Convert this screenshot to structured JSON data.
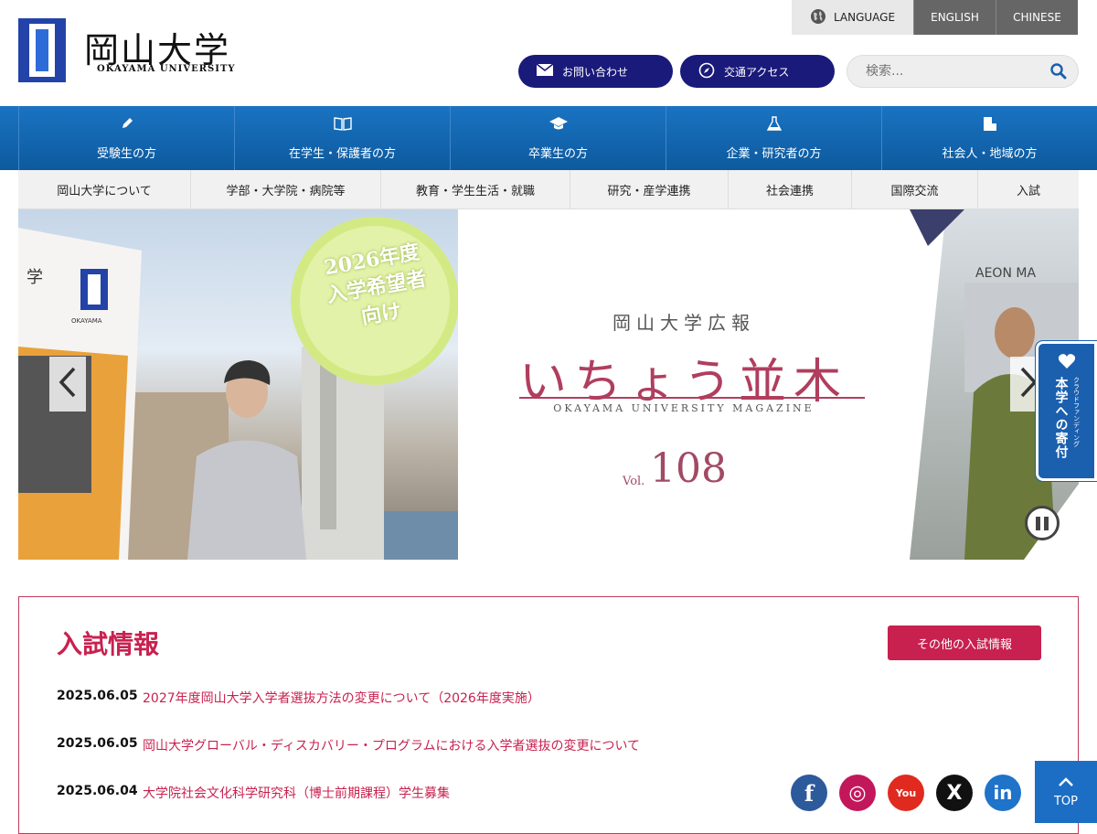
{
  "header": {
    "logo_jp": "岡山大学",
    "logo_en": "OKAYAMA UNIVERSITY",
    "language_label": "LANGUAGE",
    "languages": [
      "ENGLISH",
      "CHINESE"
    ],
    "contact_label": "お問い合わせ",
    "access_label": "交通アクセス",
    "search_placeholder": "検索..."
  },
  "audience_nav": [
    {
      "label": "受験生の方",
      "icon": "pencil-icon"
    },
    {
      "label": "在学生・保護者の方",
      "icon": "book-icon"
    },
    {
      "label": "卒業生の方",
      "icon": "graduation-cap-icon"
    },
    {
      "label": "企業・研究者の方",
      "icon": "flask-icon"
    },
    {
      "label": "社会人・地域の方",
      "icon": "building-icon"
    }
  ],
  "main_nav": [
    "岡山大学について",
    "学部・大学院・病院等",
    "教育・学生生活・就職",
    "研究・産学連携",
    "社会連携",
    "国際交流",
    "入試"
  ],
  "hero": {
    "badge_line1": "2026年度",
    "badge_line2": "入学希望者",
    "badge_line3": "向け",
    "side_char": "学",
    "card_text": "OKAYAMA",
    "magazine_kicker": "岡山大学広報",
    "magazine_title": "いちょう並木",
    "magazine_subtitle": "OKAYAMA UNIVERSITY MAGAZINE",
    "vol_label": "Vol.",
    "vol_number": "108",
    "right_sign": "AEON MA"
  },
  "donate": {
    "label": "本学への寄付",
    "sub": "クラウドファンディング"
  },
  "admissions": {
    "title": "入試情報",
    "more_label": "その他の入試情報",
    "news": [
      {
        "date": "2025.06.05",
        "title": "2027年度岡山大学入学者選抜方法の変更について（2026年度実施）"
      },
      {
        "date": "2025.06.05",
        "title": "岡山大学グローバル・ディスカバリー・プログラムにおける入学者選抜の変更について"
      },
      {
        "date": "2025.06.04",
        "title": "大学院社会文化科学研究科（博士前期課程）学生募集"
      }
    ]
  },
  "social": [
    {
      "name": "facebook-icon",
      "glyph": "f",
      "color": "#2d5a9b"
    },
    {
      "name": "instagram-icon",
      "glyph": "◎",
      "color": "#c2185b"
    },
    {
      "name": "youtube-icon",
      "glyph": "You",
      "color": "#e02a20"
    },
    {
      "name": "x-icon",
      "glyph": "X",
      "color": "#111111"
    },
    {
      "name": "linkedin-icon",
      "glyph": "in",
      "color": "#1f73c9"
    }
  ],
  "top_label": "TOP",
  "colors": {
    "primary_blue": "#1a73c2",
    "navy": "#1a1a7a",
    "accent_red": "#c8214f"
  }
}
